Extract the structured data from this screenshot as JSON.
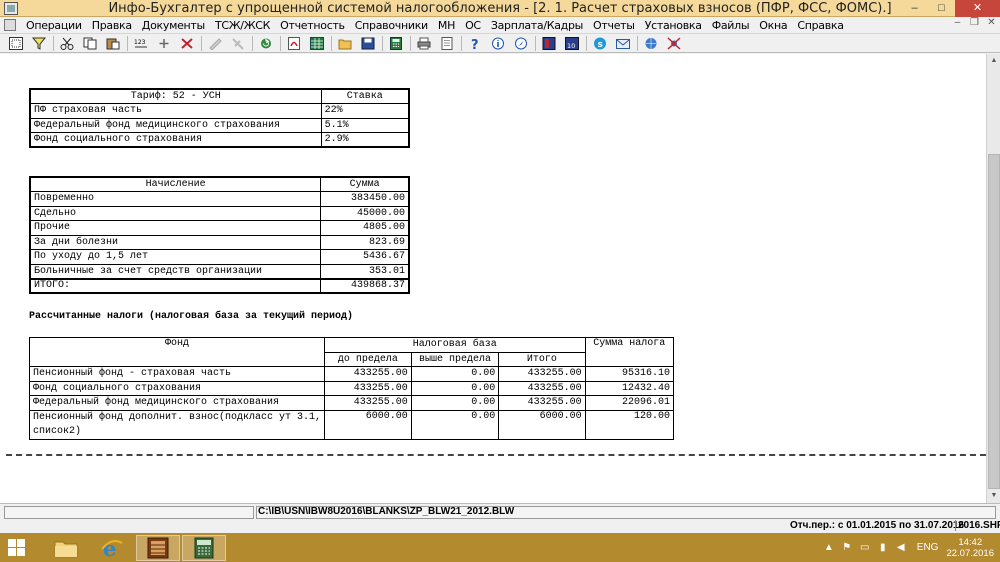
{
  "window": {
    "title": "Инфо-Бухгалтер с упрощенной системой налогообложения - [2. 1. Расчет страховых взносов (ПФР, ФСС, ФОМС).]",
    "minimize": "‒",
    "maximize": "□",
    "close": "✕"
  },
  "menu": [
    "Операции",
    "Правка",
    "Документы",
    "ТСЖ/ЖСК",
    "Отчетность",
    "Справочники",
    "МН",
    "ОС",
    "Зарплата/Кадры",
    "Отчеты",
    "Установка",
    "Файлы",
    "Окна",
    "Справка"
  ],
  "menu_right": [
    "‒",
    "❐",
    "✕"
  ],
  "toolbar_icons": [
    "select-all-icon",
    "filter-icon",
    "cut-icon",
    "copy-icon",
    "paste-icon",
    "numbering-icon",
    "add-icon",
    "delete-icon",
    "disabled-pen-icon",
    "disabled-tool-icon",
    "refresh-icon",
    "pdf-icon",
    "excel-icon",
    "open-folder-icon",
    "save-icon",
    "calculator-icon",
    "print-icon",
    "preview-icon",
    "help-icon",
    "info-icon",
    "compass-icon",
    "book-icon",
    "calendar-icon",
    "skype-icon",
    "mail-icon",
    "web-icon",
    "network-icon"
  ],
  "table_rates": {
    "header": [
      "Тариф: 52 - УСН",
      "Ставка"
    ],
    "rows": [
      [
        "ПФ страховая часть",
        "22%"
      ],
      [
        "Федеральный фонд медицинского страхования",
        "5.1%"
      ],
      [
        "Фонд социального страхования",
        "2.9%"
      ]
    ]
  },
  "table_accruals": {
    "header": [
      "Начисление",
      "Сумма"
    ],
    "rows": [
      [
        "Повременно",
        "383450.00"
      ],
      [
        "Сдельно",
        "45000.00"
      ],
      [
        "Прочие",
        "4805.00"
      ],
      [
        "За дни болезни",
        "823.69"
      ],
      [
        "По уходу до 1,5 лет",
        "5436.67"
      ],
      [
        "Больничные за счет средств организации",
        "353.01"
      ]
    ],
    "total_label": "ИТОГО:",
    "total_value": "439868.37"
  },
  "section_title": "Рассчитанные налоги (налоговая база за текущий период)",
  "table_taxes": {
    "col_fund": "Фонд",
    "col_base": "Налоговая база",
    "col_base_sub": [
      "до предела",
      "выше предела",
      "Итого"
    ],
    "col_tax": "Сумма налога",
    "rows": [
      [
        "Пенсионный фонд - страховая часть",
        "433255.00",
        "0.00",
        "433255.00",
        "95316.10"
      ],
      [
        "Фонд социального страхования",
        "433255.00",
        "0.00",
        "433255.00",
        "12432.40"
      ],
      [
        "Федеральный фонд медицинского страхования",
        "433255.00",
        "0.00",
        "433255.00",
        "22096.01"
      ]
    ],
    "last_row": {
      "fund_line1": "Пенсионный фонд дополнит. взнос(подкласс ут 3.1,",
      "fund_line2": "список2)",
      "below": "6000.00",
      "above": "0.00",
      "total": "6000.00",
      "tax": "120.00"
    }
  },
  "status": {
    "path": "C:\\IB\\USN\\IBW8U2016\\BLANKS\\ZP_BLW21_2012.BLW",
    "period": "Отч.пер.: с 01.01.2015 по 31.07.2016",
    "file": "2016.SHP"
  },
  "taskbar": {
    "apps": [
      "file-explorer-icon",
      "internet-explorer-icon",
      "abacus-app-icon",
      "calculator-app-icon"
    ],
    "tray_icons": [
      "show-hidden-icon",
      "flag-icon",
      "monitor-icon",
      "network-icon",
      "volume-icon"
    ],
    "lang": "ENG",
    "time": "14:42",
    "date": "22.07.2016"
  },
  "colors": {
    "titlebar": "#f5d99b",
    "taskbar": "#b48a2e",
    "close": "#c7463b"
  }
}
